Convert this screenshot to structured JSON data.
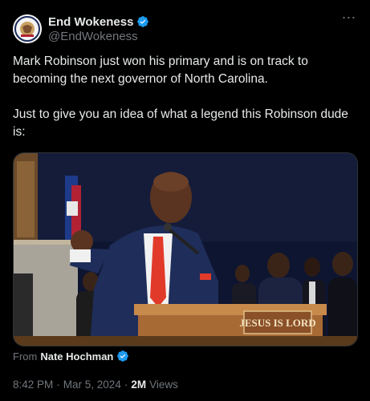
{
  "author": {
    "display_name": "End Wokeness",
    "handle": "@EndWokeness",
    "avatar_text_top": "CENTURY OF",
    "avatar_text_bottom": "WOKE BULLSHIT",
    "verified_color": "#1d9bf0"
  },
  "menu": {
    "more_icon": "⋯"
  },
  "tweet": {
    "text": "Mark Robinson just won his primary and is on track to becoming the next governor of North Carolina.\n\nJust to give you an idea of what a legend this Robinson dude is:"
  },
  "media": {
    "type": "video",
    "podium_sign": "JESUS IS LORD"
  },
  "attribution": {
    "from_label": "From",
    "from_name": "Nate Hochman"
  },
  "meta": {
    "time": "8:42 PM",
    "separator": "·",
    "date": "Mar 5, 2024",
    "views_count": "2M",
    "views_label": "Views"
  }
}
